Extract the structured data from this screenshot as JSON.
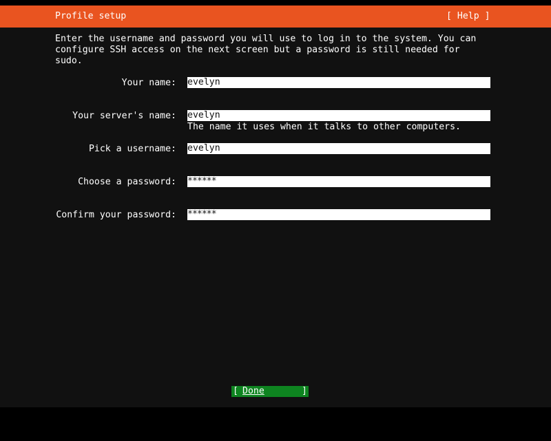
{
  "header": {
    "title": "Profile setup",
    "help_label": "[ Help ]"
  },
  "intro": "Enter the username and password you will use to log in to the system. You can\nconfigure SSH access on the next screen but a password is still needed for\nsudo.",
  "form": {
    "your_name": {
      "label": "Your name:",
      "value": "evelyn"
    },
    "server_name": {
      "label": "Your server's name:",
      "value": "evelyn",
      "hint": "The name it uses when it talks to other computers."
    },
    "username": {
      "label": "Pick a username:",
      "value": "evelyn"
    },
    "password": {
      "label": "Choose a password:",
      "value": "******"
    },
    "confirm_password": {
      "label": "Confirm your password:",
      "value": "******"
    }
  },
  "footer": {
    "done_label": "Done",
    "bracket_left": "[",
    "bracket_right": "]"
  },
  "colors": {
    "header_bg": "#e95420",
    "done_bg": "#0e8420",
    "screen_bg": "#111111"
  }
}
